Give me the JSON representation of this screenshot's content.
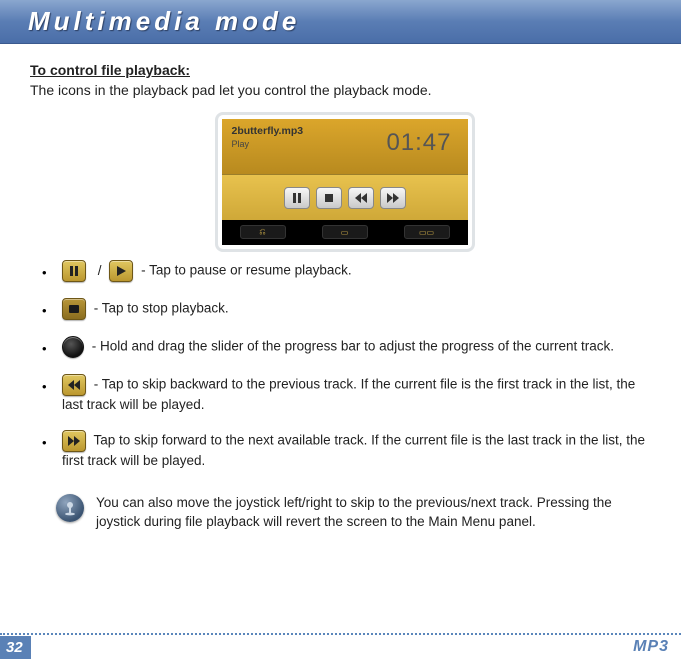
{
  "header": {
    "title": "Multimedia mode"
  },
  "section": {
    "subhead": "To control file playback:",
    "intro": "The icons in the playback pad let you control the playback mode."
  },
  "player": {
    "track": "2butterfly.mp3",
    "state": "Play",
    "time": "01:47"
  },
  "controls": {
    "pause_play": "- Tap to pause or resume playback.",
    "stop": "- Tap to stop playback.",
    "slider": "- Hold and drag the slider of the progress bar to adjust the progress of the current track.",
    "prev": "- Tap to skip backward to the previous track. If the current file is the first track in the list, the last track will be played.",
    "next": "Tap to skip forward to the next available track. If the current file is the last track in the list, the first track will be played.",
    "separator": "/"
  },
  "tip": {
    "text": "You can also move the joystick left/right to skip to the previous/next track. Pressing the joystick during file playback will revert the screen to the Main Menu panel."
  },
  "footer": {
    "page": "32",
    "label": "MP3"
  }
}
